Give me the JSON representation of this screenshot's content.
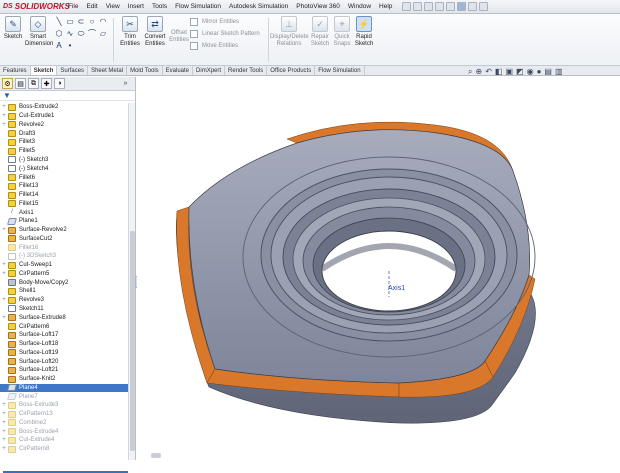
{
  "app": {
    "name": "SOLIDWORKS",
    "brand_color": "#c8102e"
  },
  "menu": [
    "File",
    "Edit",
    "View",
    "Insert",
    "Tools",
    "Flow Simulation",
    "Autodesk Simulation",
    "PhotoView 360",
    "Window",
    "Help"
  ],
  "ribbon": {
    "sketch": "Sketch",
    "smart_dimension": "Smart Dimension",
    "trim_entities": "Trim Entities",
    "convert_entities": "Convert Entities",
    "offset_entities": "Offset Entities",
    "mirror_entities": "Mirror Entities",
    "linear_sketch_pattern": "Linear Sketch Pattern",
    "move_entities": "Move Entities",
    "display_delete_relations": "Display/Delete Relations",
    "repair_sketch": "Repair Sketch",
    "quick_snaps": "Quick Snaps",
    "rapid_sketch": "Rapid Sketch"
  },
  "tabs": [
    "Features",
    "Sketch",
    "Surfaces",
    "Sheet Metal",
    "Mold Tools",
    "Evaluate",
    "DimXpert",
    "Render Tools",
    "Office Products",
    "Flow Simulation"
  ],
  "active_tab": "Sketch",
  "tree": [
    {
      "label": "Boss-Extrude2",
      "icon": "feature",
      "expandable": true
    },
    {
      "label": "Cut-Extrude1",
      "icon": "feature",
      "expandable": true
    },
    {
      "label": "Revolve2",
      "icon": "feature",
      "expandable": true
    },
    {
      "label": "Draft3",
      "icon": "feature",
      "expandable": false
    },
    {
      "label": "Fillet3",
      "icon": "feature",
      "expandable": false
    },
    {
      "label": "Fillet5",
      "icon": "feature",
      "expandable": false
    },
    {
      "label": "(-) Sketch3",
      "icon": "sketch",
      "expandable": false
    },
    {
      "label": "(-) Sketch4",
      "icon": "sketch",
      "expandable": false
    },
    {
      "label": "Fillet6",
      "icon": "feature",
      "expandable": false
    },
    {
      "label": "Fillet13",
      "icon": "feature",
      "expandable": false
    },
    {
      "label": "Fillet14",
      "icon": "feature",
      "expandable": false
    },
    {
      "label": "Fillet15",
      "icon": "feature",
      "expandable": false
    },
    {
      "label": "Axis1",
      "icon": "axis",
      "expandable": false
    },
    {
      "label": "Plane1",
      "icon": "plane",
      "expandable": false
    },
    {
      "label": "Surface-Revolve2",
      "icon": "surface",
      "expandable": true
    },
    {
      "label": "SurfaceCut2",
      "icon": "surface",
      "expandable": false
    },
    {
      "label": "Fillet16",
      "icon": "feature",
      "expandable": false,
      "dim": true
    },
    {
      "label": "(-) 3DSketch3",
      "icon": "sketch",
      "expandable": false,
      "dim": true
    },
    {
      "label": "Cut-Sweep1",
      "icon": "feature",
      "expandable": true
    },
    {
      "label": "CirPattern5",
      "icon": "feature",
      "expandable": true
    },
    {
      "label": "Body-Move/Copy2",
      "icon": "body",
      "expandable": false
    },
    {
      "label": "Shell1",
      "icon": "feature",
      "expandable": false
    },
    {
      "label": "Revolve3",
      "icon": "feature",
      "expandable": true
    },
    {
      "label": "Sketch11",
      "icon": "sketch",
      "expandable": false
    },
    {
      "label": "Surface-Extrude8",
      "icon": "surface",
      "expandable": true
    },
    {
      "label": "CirPattern6",
      "icon": "feature",
      "expandable": false
    },
    {
      "label": "Surface-Loft17",
      "icon": "surface",
      "expandable": false
    },
    {
      "label": "Surface-Loft18",
      "icon": "surface",
      "expandable": false
    },
    {
      "label": "Surface-Loft19",
      "icon": "surface",
      "expandable": false
    },
    {
      "label": "Surface-Loft20",
      "icon": "surface",
      "expandable": false
    },
    {
      "label": "Surface-Loft21",
      "icon": "surface",
      "expandable": false
    },
    {
      "label": "Surface-Knit2",
      "icon": "surface",
      "expandable": false
    },
    {
      "label": "Plane4",
      "icon": "plane",
      "expandable": false,
      "selected": true
    },
    {
      "label": "Plane7",
      "icon": "plane",
      "expandable": false,
      "dim": true
    },
    {
      "label": "Boss-Extrude3",
      "icon": "feature",
      "expandable": true,
      "dim": true
    },
    {
      "label": "CirPattern13",
      "icon": "feature",
      "expandable": true,
      "dim": true
    },
    {
      "label": "Combine2",
      "icon": "feature",
      "expandable": true,
      "dim": true
    },
    {
      "label": "Boss-Extrude4",
      "icon": "feature",
      "expandable": true,
      "dim": true
    },
    {
      "label": "Cut-Extrude4",
      "icon": "feature",
      "expandable": true,
      "dim": true
    },
    {
      "label": "CirPattern8",
      "icon": "feature",
      "expandable": true,
      "dim": true
    }
  ],
  "viewport": {
    "axis_label": "Axis1",
    "model_colors": {
      "face": "#9096a8",
      "face_dark": "#6f7588",
      "edge_orange": "#d9782b"
    }
  }
}
